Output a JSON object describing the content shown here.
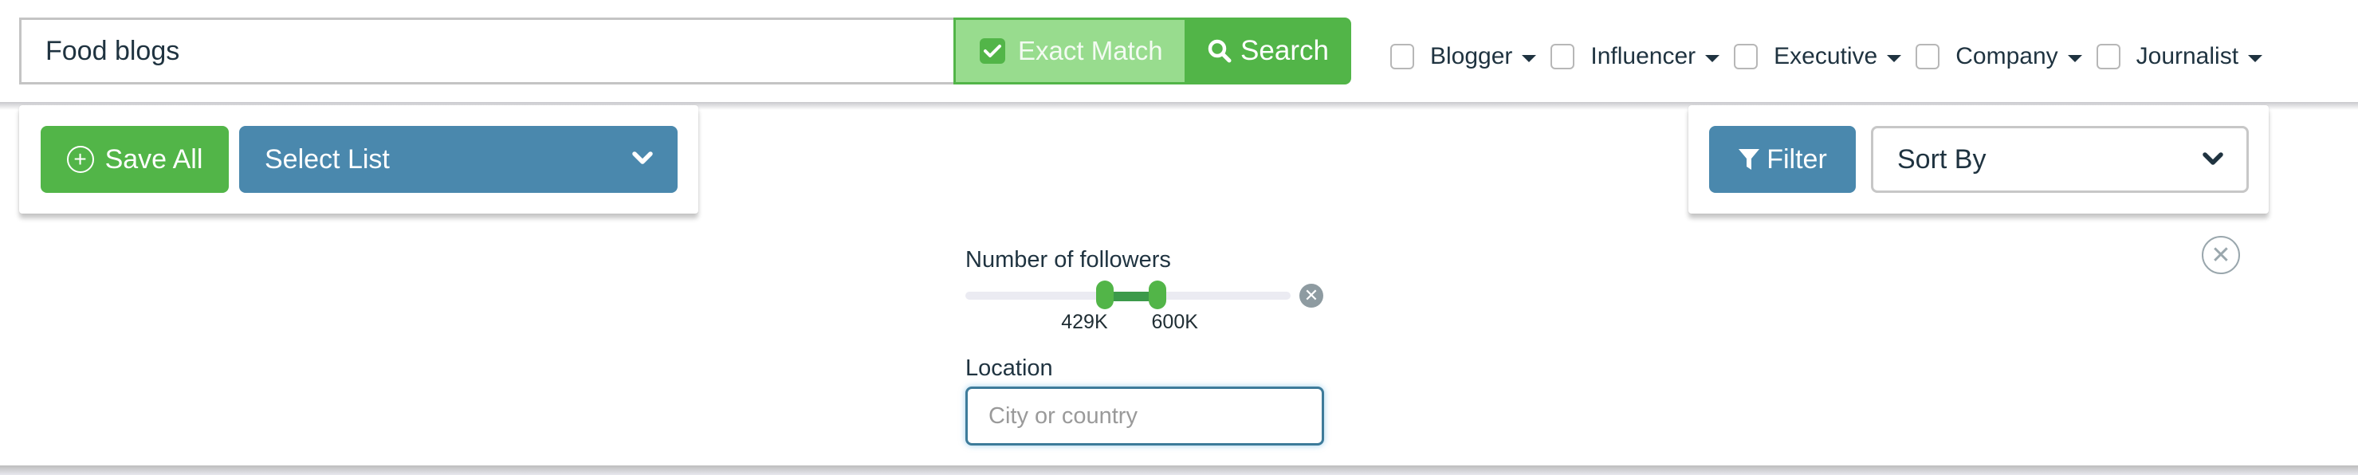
{
  "search": {
    "query": "Food blogs",
    "exact_match_label": "Exact Match",
    "exact_match_checked": true,
    "search_label": "Search"
  },
  "types": [
    {
      "label": "Blogger",
      "checked": false
    },
    {
      "label": "Influencer",
      "checked": false
    },
    {
      "label": "Executive",
      "checked": false
    },
    {
      "label": "Company",
      "checked": false
    },
    {
      "label": "Journalist",
      "checked": false
    }
  ],
  "toolbar": {
    "save_all_label": "Save All",
    "select_list_label": "Select List",
    "filter_label": "Filter",
    "sort_by_label": "Sort By"
  },
  "followers": {
    "label": "Number of followers",
    "min_label": "429K",
    "max_label": "600K",
    "min_fraction": 0.43,
    "max_fraction": 0.59
  },
  "location": {
    "label": "Location",
    "value": "",
    "placeholder": "City or country"
  },
  "colors": {
    "green": "#52b548",
    "light_green": "#98dc8e",
    "blue": "#4a88ad",
    "text": "#1f3340"
  }
}
